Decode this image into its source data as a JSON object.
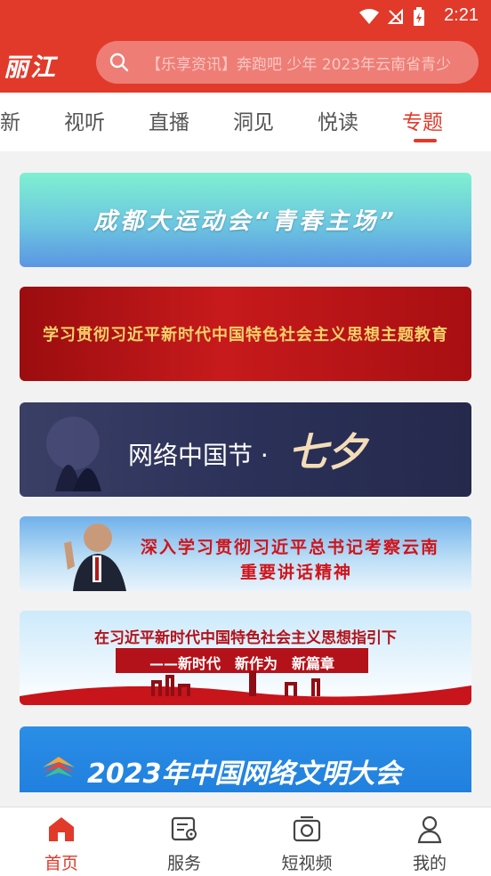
{
  "status": {
    "time": "2:21"
  },
  "header": {
    "logo_text": "丽江",
    "search_placeholder": "【乐享资讯】奔跑吧 少年 2023年云南省青少"
  },
  "tabs": [
    {
      "label": "新"
    },
    {
      "label": "视听"
    },
    {
      "label": "直播"
    },
    {
      "label": "洞见"
    },
    {
      "label": "悦读"
    },
    {
      "label": "专题",
      "active": true
    }
  ],
  "banners": {
    "b1": "成都大运动会“青春主场”",
    "b2": "学习贯彻习近平新时代中国特色社会主义思想主题教育",
    "b3_main": "网络中国节 ·",
    "b3_accent": "七夕",
    "b4_line1": "深入学习贯彻习近平总书记考察云南",
    "b4_line2": "重要讲话精神",
    "b5_line1": "在习近平新时代中国特色社会主义思想指引下",
    "b5_line2": "——新时代　新作为　新篇章",
    "b6": "2023年中国网络文明大会"
  },
  "bottom_nav": [
    {
      "label": "首页",
      "icon": "home-icon",
      "active": true
    },
    {
      "label": "服务",
      "icon": "service-icon"
    },
    {
      "label": "短视频",
      "icon": "video-icon"
    },
    {
      "label": "我的",
      "icon": "profile-icon"
    }
  ],
  "colors": {
    "brand_red": "#e13a2a",
    "active_text": "#e13a2a"
  }
}
